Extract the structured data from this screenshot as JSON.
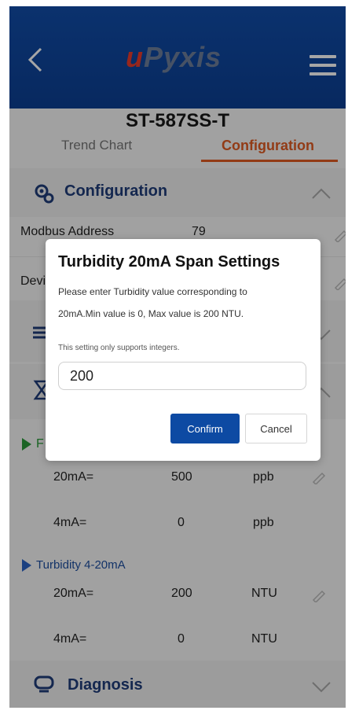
{
  "header": {
    "logo_u": "u",
    "logo_rest": "Pyxis"
  },
  "device_title": "ST-587SS-T",
  "tabs": [
    {
      "label": "Trend Chart",
      "active": false
    },
    {
      "label": "Configuration",
      "active": true
    }
  ],
  "sections": {
    "configuration": "Configuration",
    "diagnosis": "Diagnosis"
  },
  "rows": {
    "modbus_label": "Modbus Address",
    "modbus_value": "79",
    "device_label": "Devi"
  },
  "analog": {
    "group1_label": "F",
    "group1_rows": [
      {
        "label": "20mA=",
        "value": "500",
        "unit": "ppb"
      },
      {
        "label": "4mA=",
        "value": "0",
        "unit": "ppb"
      }
    ],
    "group2_label": "Turbidity 4-20mA",
    "group2_rows": [
      {
        "label": "20mA=",
        "value": "200",
        "unit": "NTU"
      },
      {
        "label": "4mA=",
        "value": "0",
        "unit": "NTU"
      }
    ]
  },
  "dialog": {
    "title": "Turbidity 20mA Span Settings",
    "line1": "Please enter Turbidity value corresponding to",
    "line2": "20mA.Min value is 0, Max value is 200 NTU.",
    "note": "This setting only supports integers.",
    "input_value": "200",
    "confirm_label": "Confirm",
    "cancel_label": "Cancel"
  },
  "colors": {
    "header_blue": "#0f4aa6",
    "accent_orange": "#e05b22",
    "section_text": "#1f3d7a"
  }
}
